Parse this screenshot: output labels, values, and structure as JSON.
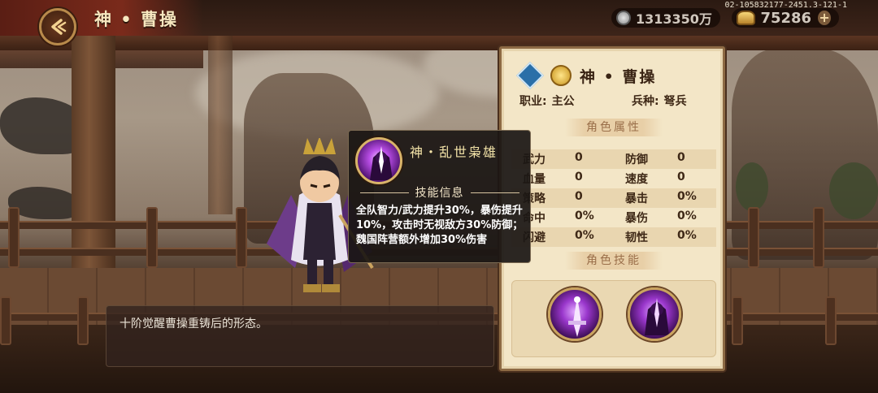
{
  "header": {
    "title": "神 • 曹操",
    "build_id": "02-105832177-2451.3-121-1",
    "silver_amount": "1313350万",
    "gold_amount": "75286",
    "back_icon": "back-arrow-icon",
    "plus_icon": "plus-icon"
  },
  "hero": {
    "description": "十阶觉醒曹操重铸后的形态。"
  },
  "tooltip": {
    "skill_name": "神・乱世枭雄",
    "section_label": "技能信息",
    "description": "全队智力/武力提升30%，暴伤提升10%，攻击时无视敌方30%防御；魏国阵营额外增加30%伤害"
  },
  "panel": {
    "name": "神 • 曹操",
    "class_label": "职业:",
    "class_value": "主公",
    "troop_label": "兵种:",
    "troop_value": "弩兵",
    "attributes_title": "角色属性",
    "skills_title": "角色技能",
    "attributes": [
      {
        "left_name": "武力",
        "left_value": "0",
        "right_name": "防御",
        "right_value": "0"
      },
      {
        "left_name": "血量",
        "left_value": "0",
        "right_name": "速度",
        "right_value": "0"
      },
      {
        "left_name": "策略",
        "left_value": "0",
        "right_name": "暴击",
        "right_value": "0%"
      },
      {
        "left_name": "命中",
        "left_value": "0%",
        "right_name": "暴伤",
        "right_value": "0%"
      },
      {
        "left_name": "闪避",
        "left_value": "0%",
        "right_name": "韧性",
        "right_value": "0%"
      }
    ]
  },
  "colors": {
    "panel_bg": "#f3e6c7",
    "panel_border": "#8d6a44",
    "skill_purple": "#9a37cc",
    "gold_text": "#f3e3a8"
  }
}
